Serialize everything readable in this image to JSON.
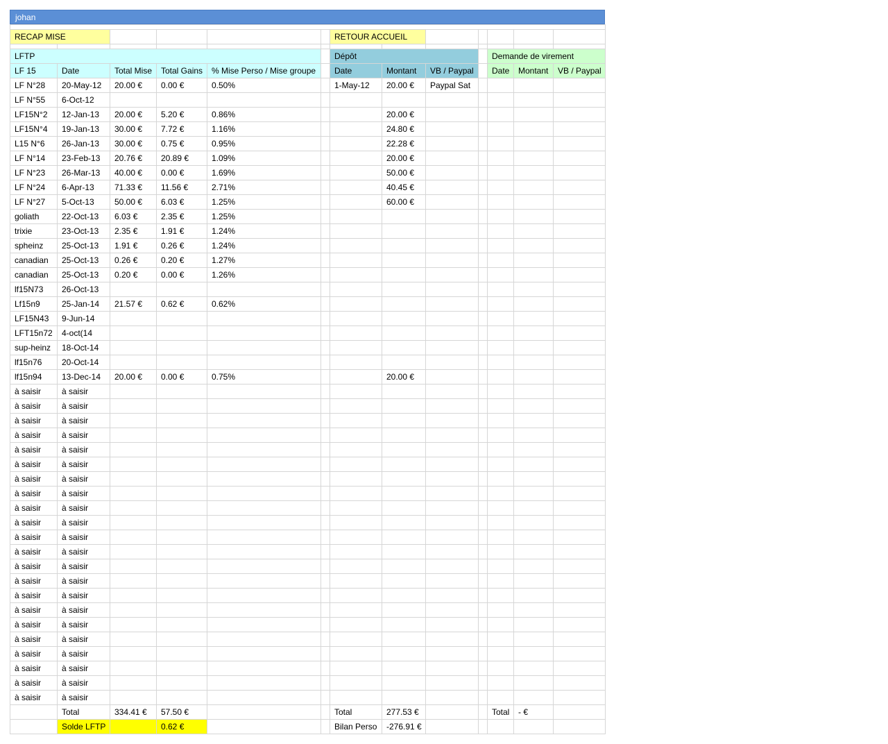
{
  "sheet_title": "johan",
  "nav": {
    "recap": "RECAP MISE",
    "retour": "RETOUR ACCUEIL"
  },
  "sections": {
    "lftp": "LFTP",
    "depot": "Dépôt",
    "virement": "Demande de virement"
  },
  "headers": {
    "lftp": [
      "LF 15",
      "Date",
      "Total Mise",
      "Total Gains",
      "% Mise Perso / Mise groupe"
    ],
    "depot": [
      "Date",
      "Montant",
      "VB / Paypal"
    ],
    "virement": [
      "Date",
      "Montant",
      "VB / Paypal"
    ]
  },
  "rows": [
    {
      "lf": "LF N°28",
      "date": "20-May-12",
      "mise": "20.00 €",
      "gains": "0.00 €",
      "pct": "0.50%",
      "d_date": "1-May-12",
      "d_montant": "20.00 €",
      "d_vb": "Paypal Sat"
    },
    {
      "lf": "LF N°55",
      "date": "6-Oct-12",
      "mise": "",
      "gains": "",
      "pct": "",
      "d_date": "",
      "d_montant": "",
      "d_vb": ""
    },
    {
      "lf": "LF15N°2",
      "date": "12-Jan-13",
      "mise": "20.00 €",
      "gains": "5.20 €",
      "pct": "0.86%",
      "d_date": "",
      "d_montant": "20.00 €",
      "d_vb": ""
    },
    {
      "lf": "LF15N°4",
      "date": "19-Jan-13",
      "mise": "30.00 €",
      "gains": "7.72 €",
      "pct": "1.16%",
      "d_date": "",
      "d_montant": "24.80 €",
      "d_vb": ""
    },
    {
      "lf": "L15 N°6",
      "date": "26-Jan-13",
      "mise": "30.00 €",
      "gains": "0.75 €",
      "pct": "0.95%",
      "d_date": "",
      "d_montant": "22.28 €",
      "d_vb": ""
    },
    {
      "lf": "LF N°14",
      "date": "23-Feb-13",
      "mise": "20.76 €",
      "gains": "20.89 €",
      "pct": "1.09%",
      "d_date": "",
      "d_montant": "20.00 €",
      "d_vb": ""
    },
    {
      "lf": "LF N°23",
      "date": "26-Mar-13",
      "mise": "40.00 €",
      "gains": "0.00 €",
      "pct": "1.69%",
      "d_date": "",
      "d_montant": "50.00 €",
      "d_vb": ""
    },
    {
      "lf": "LF N°24",
      "date": "6-Apr-13",
      "mise": "71.33 €",
      "gains": "11.56 €",
      "pct": "2.71%",
      "d_date": "",
      "d_montant": "40.45 €",
      "d_vb": ""
    },
    {
      "lf": "LF N°27",
      "date": "5-Oct-13",
      "mise": "50.00 €",
      "gains": "6.03 €",
      "pct": "1.25%",
      "d_date": "",
      "d_montant": "60.00 €",
      "d_vb": ""
    },
    {
      "lf": "goliath",
      "date": "22-Oct-13",
      "mise": "6.03 €",
      "gains": "2.35 €",
      "pct": "1.25%",
      "d_date": "",
      "d_montant": "",
      "d_vb": ""
    },
    {
      "lf": "trixie",
      "date": "23-Oct-13",
      "mise": "2.35 €",
      "gains": "1.91 €",
      "pct": "1.24%",
      "d_date": "",
      "d_montant": "",
      "d_vb": ""
    },
    {
      "lf": "spheinz",
      "date": "25-Oct-13",
      "mise": "1.91 €",
      "gains": "0.26 €",
      "pct": "1.24%",
      "d_date": "",
      "d_montant": "",
      "d_vb": ""
    },
    {
      "lf": "canadian",
      "date": "25-Oct-13",
      "mise": "0.26 €",
      "gains": "0.20 €",
      "pct": "1.27%",
      "d_date": "",
      "d_montant": "",
      "d_vb": ""
    },
    {
      "lf": "canadian",
      "date": "25-Oct-13",
      "mise": "0.20 €",
      "gains": "0.00 €",
      "pct": "1.26%",
      "d_date": "",
      "d_montant": "",
      "d_vb": ""
    },
    {
      "lf": "lf15N73",
      "date": "26-Oct-13",
      "mise": "",
      "gains": "",
      "pct": "",
      "d_date": "",
      "d_montant": "",
      "d_vb": ""
    },
    {
      "lf": "Lf15n9",
      "date": "25-Jan-14",
      "mise": "21.57 €",
      "gains": "0.62 €",
      "pct": "0.62%",
      "d_date": "",
      "d_montant": "",
      "d_vb": ""
    },
    {
      "lf": "LF15N43",
      "date": "9-Jun-14",
      "mise": "",
      "gains": "",
      "pct": "",
      "d_date": "",
      "d_montant": "",
      "d_vb": ""
    },
    {
      "lf": "LFT15n72",
      "date": "4-oct(14",
      "mise": "",
      "gains": "",
      "pct": "",
      "d_date": "",
      "d_montant": "",
      "d_vb": ""
    },
    {
      "lf": "sup-heinz",
      "date": "18-Oct-14",
      "mise": "",
      "gains": "",
      "pct": "",
      "d_date": "",
      "d_montant": "",
      "d_vb": ""
    },
    {
      "lf": "lf15n76",
      "date": "20-Oct-14",
      "mise": "",
      "gains": "",
      "pct": "",
      "d_date": "",
      "d_montant": "",
      "d_vb": ""
    },
    {
      "lf": "lf15n94",
      "date": "13-Dec-14",
      "mise": "20.00 €",
      "gains": "0.00 €",
      "pct": "0.75%",
      "d_date": "",
      "d_montant": "20.00 €",
      "d_vb": ""
    },
    {
      "lf": "à saisir",
      "date": "à saisir",
      "mise": "",
      "gains": "",
      "pct": "",
      "d_date": "",
      "d_montant": "",
      "d_vb": ""
    },
    {
      "lf": "à saisir",
      "date": "à saisir",
      "mise": "",
      "gains": "",
      "pct": "",
      "d_date": "",
      "d_montant": "",
      "d_vb": ""
    },
    {
      "lf": "à saisir",
      "date": "à saisir",
      "mise": "",
      "gains": "",
      "pct": "",
      "d_date": "",
      "d_montant": "",
      "d_vb": ""
    },
    {
      "lf": "à saisir",
      "date": "à saisir",
      "mise": "",
      "gains": "",
      "pct": "",
      "d_date": "",
      "d_montant": "",
      "d_vb": ""
    },
    {
      "lf": "à saisir",
      "date": "à saisir",
      "mise": "",
      "gains": "",
      "pct": "",
      "d_date": "",
      "d_montant": "",
      "d_vb": ""
    },
    {
      "lf": "à saisir",
      "date": "à saisir",
      "mise": "",
      "gains": "",
      "pct": "",
      "d_date": "",
      "d_montant": "",
      "d_vb": ""
    },
    {
      "lf": "à saisir",
      "date": "à saisir",
      "mise": "",
      "gains": "",
      "pct": "",
      "d_date": "",
      "d_montant": "",
      "d_vb": ""
    },
    {
      "lf": "à saisir",
      "date": "à saisir",
      "mise": "",
      "gains": "",
      "pct": "",
      "d_date": "",
      "d_montant": "",
      "d_vb": ""
    },
    {
      "lf": "à saisir",
      "date": "à saisir",
      "mise": "",
      "gains": "",
      "pct": "",
      "d_date": "",
      "d_montant": "",
      "d_vb": ""
    },
    {
      "lf": "à saisir",
      "date": "à saisir",
      "mise": "",
      "gains": "",
      "pct": "",
      "d_date": "",
      "d_montant": "",
      "d_vb": ""
    },
    {
      "lf": "à saisir",
      "date": "à saisir",
      "mise": "",
      "gains": "",
      "pct": "",
      "d_date": "",
      "d_montant": "",
      "d_vb": ""
    },
    {
      "lf": "à saisir",
      "date": "à saisir",
      "mise": "",
      "gains": "",
      "pct": "",
      "d_date": "",
      "d_montant": "",
      "d_vb": ""
    },
    {
      "lf": "à saisir",
      "date": "à saisir",
      "mise": "",
      "gains": "",
      "pct": "",
      "d_date": "",
      "d_montant": "",
      "d_vb": ""
    },
    {
      "lf": "à saisir",
      "date": "à saisir",
      "mise": "",
      "gains": "",
      "pct": "",
      "d_date": "",
      "d_montant": "",
      "d_vb": ""
    },
    {
      "lf": "à saisir",
      "date": "à saisir",
      "mise": "",
      "gains": "",
      "pct": "",
      "d_date": "",
      "d_montant": "",
      "d_vb": ""
    },
    {
      "lf": "à saisir",
      "date": "à saisir",
      "mise": "",
      "gains": "",
      "pct": "",
      "d_date": "",
      "d_montant": "",
      "d_vb": ""
    },
    {
      "lf": "à saisir",
      "date": "à saisir",
      "mise": "",
      "gains": "",
      "pct": "",
      "d_date": "",
      "d_montant": "",
      "d_vb": ""
    },
    {
      "lf": "à saisir",
      "date": "à saisir",
      "mise": "",
      "gains": "",
      "pct": "",
      "d_date": "",
      "d_montant": "",
      "d_vb": ""
    },
    {
      "lf": "à saisir",
      "date": "à saisir",
      "mise": "",
      "gains": "",
      "pct": "",
      "d_date": "",
      "d_montant": "",
      "d_vb": ""
    },
    {
      "lf": "à saisir",
      "date": "à saisir",
      "mise": "",
      "gains": "",
      "pct": "",
      "d_date": "",
      "d_montant": "",
      "d_vb": ""
    },
    {
      "lf": "à saisir",
      "date": "à saisir",
      "mise": "",
      "gains": "",
      "pct": "",
      "d_date": "",
      "d_montant": "",
      "d_vb": ""
    },
    {
      "lf": "à saisir",
      "date": "à saisir",
      "mise": "",
      "gains": "",
      "pct": "",
      "d_date": "",
      "d_montant": "",
      "d_vb": ""
    }
  ],
  "totals": {
    "label": "Total",
    "mise": "334.41 €",
    "gains": "57.50 €",
    "depot_label": "Total",
    "depot_montant": "277.53 €",
    "virement_label": "Total",
    "virement_montant": "- €"
  },
  "solde": {
    "label": "Solde LFTP",
    "value": "0.62 €",
    "bilan_label": "Bilan Perso",
    "bilan_value": "-276.91 €"
  },
  "colors": {
    "title_bar": "#5b8fd6",
    "yellow": "#ffff9e",
    "cyan": "#ccffff",
    "blue": "#93cddd",
    "green": "#ccffcc",
    "highlight": "#ffff00"
  }
}
